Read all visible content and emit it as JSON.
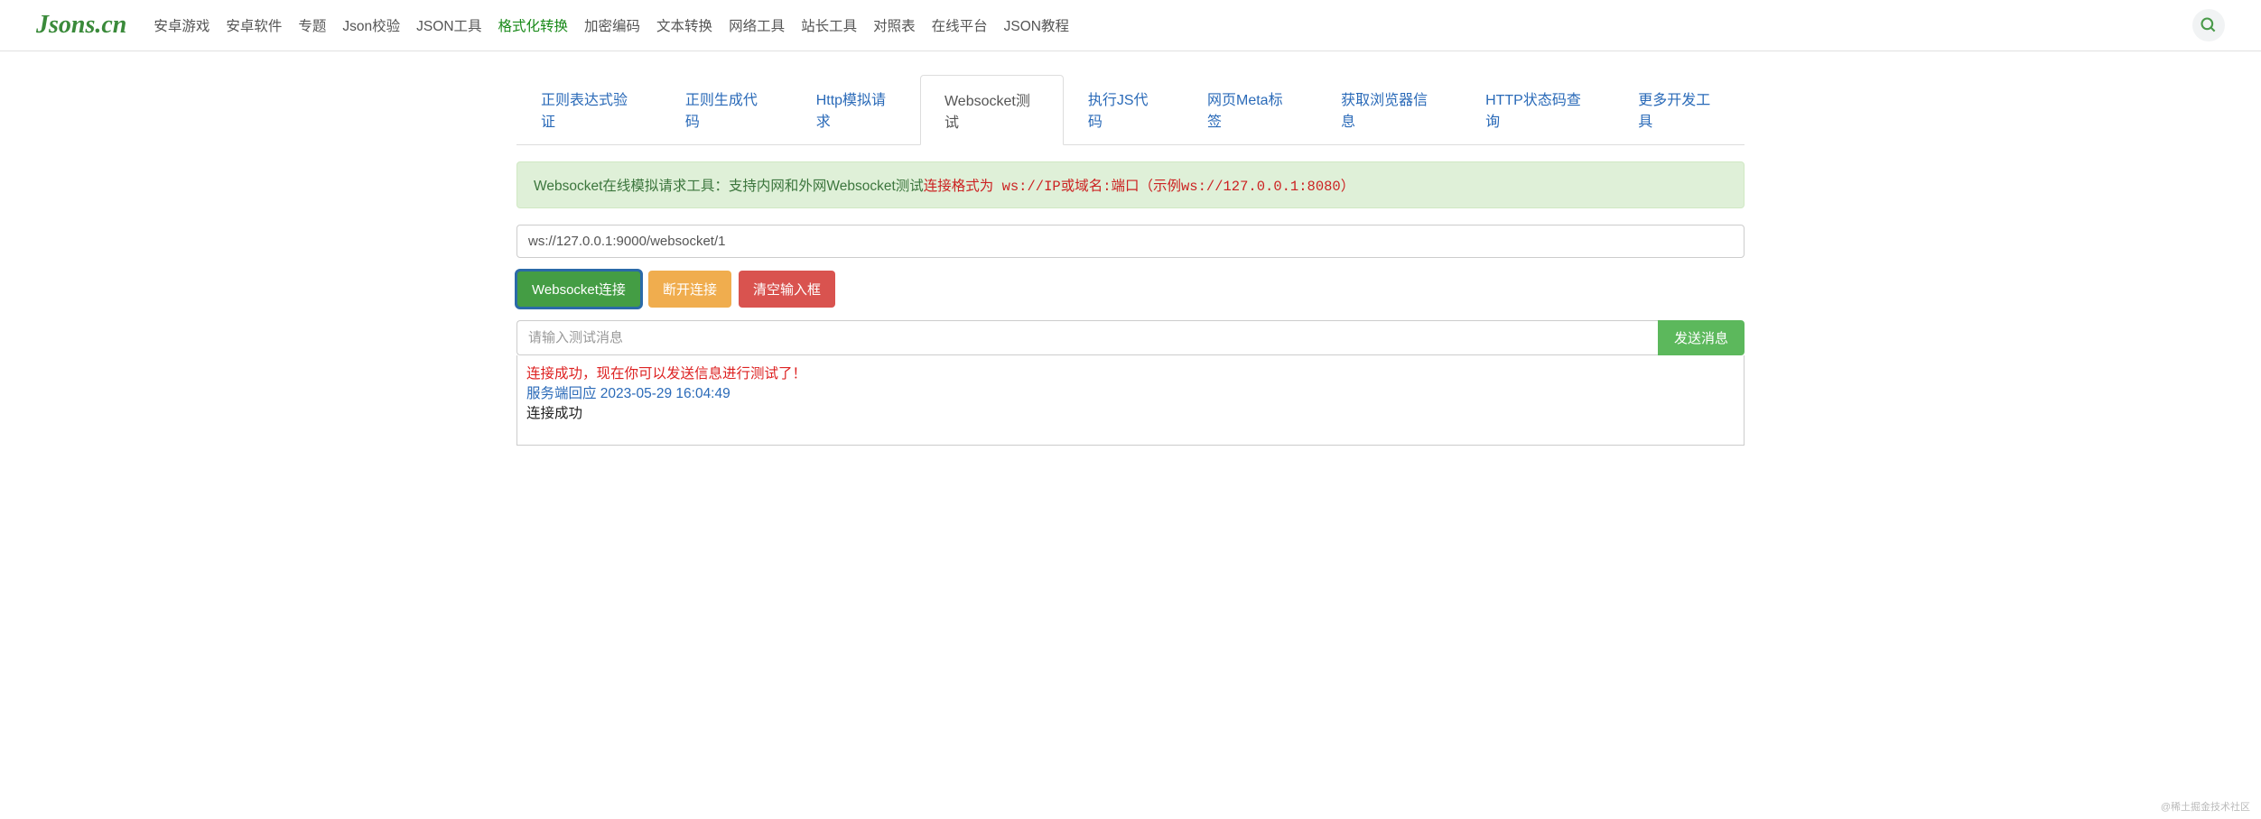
{
  "header": {
    "logo": "Jsons.cn",
    "nav": [
      {
        "label": "安卓游戏",
        "active": false
      },
      {
        "label": "安卓软件",
        "active": false
      },
      {
        "label": "专题",
        "active": false
      },
      {
        "label": "Json校验",
        "active": false
      },
      {
        "label": "JSON工具",
        "active": false
      },
      {
        "label": "格式化转换",
        "active": true
      },
      {
        "label": "加密编码",
        "active": false
      },
      {
        "label": "文本转换",
        "active": false
      },
      {
        "label": "网络工具",
        "active": false
      },
      {
        "label": "站长工具",
        "active": false
      },
      {
        "label": "对照表",
        "active": false
      },
      {
        "label": "在线平台",
        "active": false
      },
      {
        "label": "JSON教程",
        "active": false
      }
    ]
  },
  "subtabs": [
    {
      "label": "正则表达式验证",
      "active": false
    },
    {
      "label": "正则生成代码",
      "active": false
    },
    {
      "label": "Http模拟请求",
      "active": false
    },
    {
      "label": "Websocket测试",
      "active": true
    },
    {
      "label": "执行JS代码",
      "active": false
    },
    {
      "label": "网页Meta标签",
      "active": false
    },
    {
      "label": "获取浏览器信息",
      "active": false
    },
    {
      "label": "HTTP状态码查询",
      "active": false
    },
    {
      "label": "更多开发工具",
      "active": false
    }
  ],
  "alert": {
    "text1": "Websocket在线模拟请求工具：支持内网和外网Websocket测试",
    "text2": "连接格式为 ws://IP或域名:端口（示例ws://127.0.0.1:8080）"
  },
  "url_value": "ws://127.0.0.1:9000/websocket/1",
  "buttons": {
    "connect": "Websocket连接",
    "disconnect": "断开连接",
    "clear": "清空输入框"
  },
  "msg": {
    "placeholder": "请输入测试消息",
    "send": "发送消息"
  },
  "log": {
    "line1": "连接成功，现在你可以发送信息进行测试了！",
    "line2": "服务端回应 2023-05-29 16:04:49",
    "line3": "连接成功"
  },
  "watermark": "@稀土掘金技术社区"
}
